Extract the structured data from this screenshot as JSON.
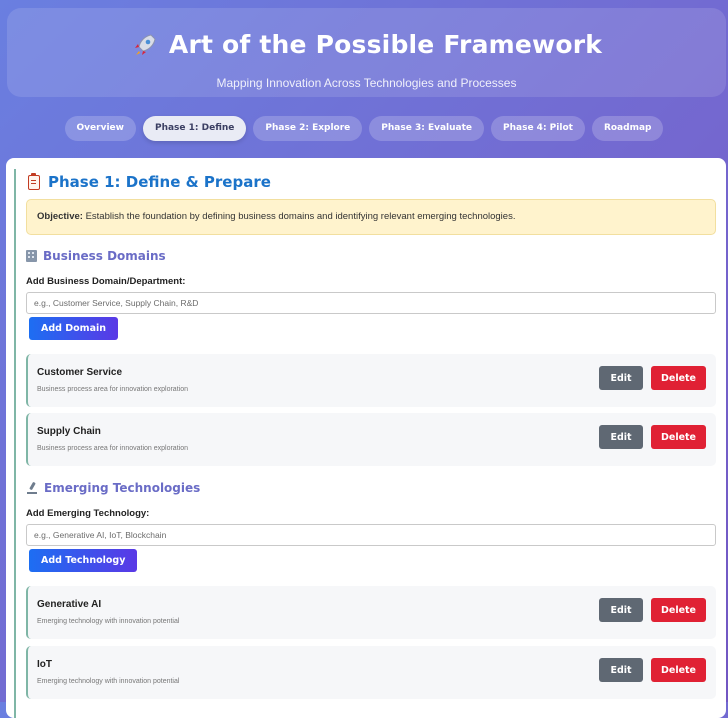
{
  "header": {
    "icon": "rocket-icon",
    "title": "Art of the Possible Framework",
    "subtitle": "Mapping Innovation Across Technologies and Processes"
  },
  "tabs": [
    {
      "label": "Overview",
      "active": false
    },
    {
      "label": "Phase 1: Define",
      "active": true
    },
    {
      "label": "Phase 2: Explore",
      "active": false
    },
    {
      "label": "Phase 3: Evaluate",
      "active": false
    },
    {
      "label": "Phase 4: Pilot",
      "active": false
    },
    {
      "label": "Roadmap",
      "active": false
    }
  ],
  "phase": {
    "icon": "clipboard-icon",
    "title": "Phase 1: Define & Prepare",
    "objective_label": "Objective:",
    "objective_text": "Establish the foundation by defining business domains and identifying relevant emerging technologies."
  },
  "domains": {
    "icon": "building-icon",
    "title": "Business Domains",
    "field_label": "Add Business Domain/Department:",
    "placeholder": "e.g., Customer Service, Supply Chain, R&D",
    "value": "",
    "add_label": "Add Domain",
    "items": [
      {
        "name": "Customer Service",
        "desc": "Business process area for innovation exploration"
      },
      {
        "name": "Supply Chain",
        "desc": "Business process area for innovation exploration"
      }
    ]
  },
  "technologies": {
    "icon": "microscope-icon",
    "title": "Emerging Technologies",
    "field_label": "Add Emerging Technology:",
    "placeholder": "e.g., Generative AI, IoT, Blockchain",
    "value": "",
    "add_label": "Add Technology",
    "items": [
      {
        "name": "Generative AI",
        "desc": "Emerging technology with innovation potential"
      },
      {
        "name": "IoT",
        "desc": "Emerging technology with innovation potential"
      }
    ]
  },
  "actions": {
    "edit_label": "Edit",
    "delete_label": "Delete"
  },
  "colors": {
    "accent_blue": "#1b73c9",
    "section_purple": "#6a6cc6",
    "delete_red": "#e02134",
    "edit_gray": "#5f6873",
    "objective_bg": "#fff3cd"
  }
}
